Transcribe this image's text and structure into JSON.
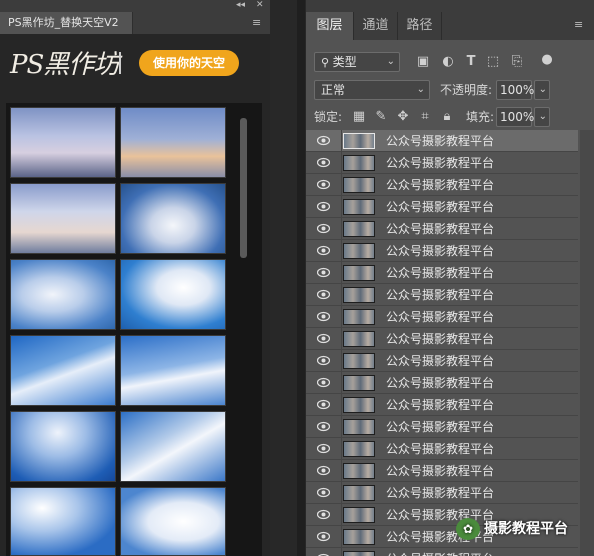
{
  "left_panel": {
    "tab_title": "PS黑作坊_替换天空V2",
    "logo_text": "PS黑作坊",
    "cta_label": "使用你的天空",
    "icons": {
      "collapse": "double-chevron-icon",
      "close": "close-icon",
      "menu": "hamburger-menu-icon"
    }
  },
  "right_panel": {
    "tabs": [
      {
        "label": "图层"
      },
      {
        "label": "通道"
      },
      {
        "label": "路径"
      }
    ],
    "filter": {
      "label": "类型",
      "icon": "search-icon"
    },
    "filter_icons": [
      "image-filter-icon",
      "adjustment-filter-icon",
      "text-filter-icon",
      "shape-filter-icon",
      "smart-object-filter-icon",
      "filter-toggle-icon"
    ],
    "blend_mode": "正常",
    "opacity_label": "不透明度:",
    "opacity_value": "100%",
    "lock_label": "锁定:",
    "lock_icons": [
      "lock-pixels-icon",
      "lock-image-icon",
      "lock-position-icon",
      "lock-artboard-icon",
      "lock-all-icon"
    ],
    "fill_label": "填充:",
    "fill_value": "100%",
    "layers": [
      {
        "name": "公众号摄影教程平台",
        "selected": true
      },
      {
        "name": "公众号摄影教程平台"
      },
      {
        "name": "公众号摄影教程平台"
      },
      {
        "name": "公众号摄影教程平台"
      },
      {
        "name": "公众号摄影教程平台"
      },
      {
        "name": "公众号摄影教程平台"
      },
      {
        "name": "公众号摄影教程平台"
      },
      {
        "name": "公众号摄影教程平台"
      },
      {
        "name": "公众号摄影教程平台"
      },
      {
        "name": "公众号摄影教程平台"
      },
      {
        "name": "公众号摄影教程平台"
      },
      {
        "name": "公众号摄影教程平台"
      },
      {
        "name": "公众号摄影教程平台"
      },
      {
        "name": "公众号摄影教程平台"
      },
      {
        "name": "公众号摄影教程平台"
      },
      {
        "name": "公众号摄影教程平台"
      },
      {
        "name": "公众号摄影教程平台"
      },
      {
        "name": "公众号摄影教程平台"
      },
      {
        "name": "公众号摄影教程平台"
      },
      {
        "name": "公众号摄影教程平台"
      }
    ]
  },
  "watermark": "摄影教程平台"
}
